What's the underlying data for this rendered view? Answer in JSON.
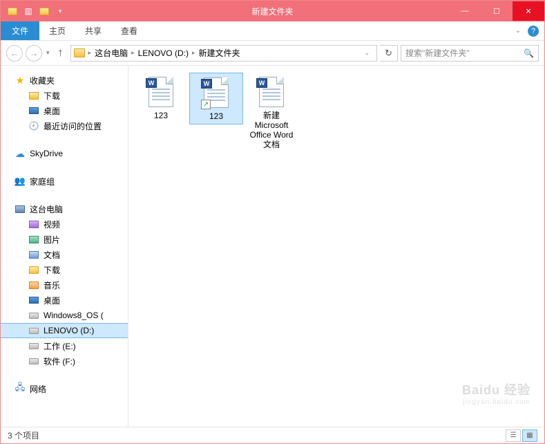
{
  "window": {
    "title": "新建文件夹"
  },
  "ribbon": {
    "file": "文件",
    "tabs": [
      "主页",
      "共享",
      "查看"
    ]
  },
  "breadcrumb": {
    "parts": [
      "这台电脑",
      "LENOVO (D:)",
      "新建文件夹"
    ]
  },
  "search": {
    "placeholder": "搜索\"新建文件夹\""
  },
  "nav": {
    "favorites": {
      "label": "收藏夹",
      "items": [
        "下载",
        "桌面",
        "最近访问的位置"
      ]
    },
    "skydrive": "SkyDrive",
    "homegroup": "家庭组",
    "thispc": {
      "label": "这台电脑",
      "items": [
        "视频",
        "图片",
        "文档",
        "下载",
        "音乐",
        "桌面",
        "Windows8_OS (",
        "LENOVO (D:)",
        "工作 (E:)",
        "软件 (F:)"
      ]
    },
    "network": "网络"
  },
  "files": [
    {
      "name": "123",
      "shortcut": false,
      "selected": false
    },
    {
      "name": "123",
      "shortcut": true,
      "selected": true
    },
    {
      "name": "新建 Microsoft Office Word 文档",
      "shortcut": false,
      "selected": false
    }
  ],
  "status": {
    "count": "3 个项目"
  },
  "watermark": {
    "brand": "Baidu 经验",
    "url": "jingyan.baidu.com"
  }
}
